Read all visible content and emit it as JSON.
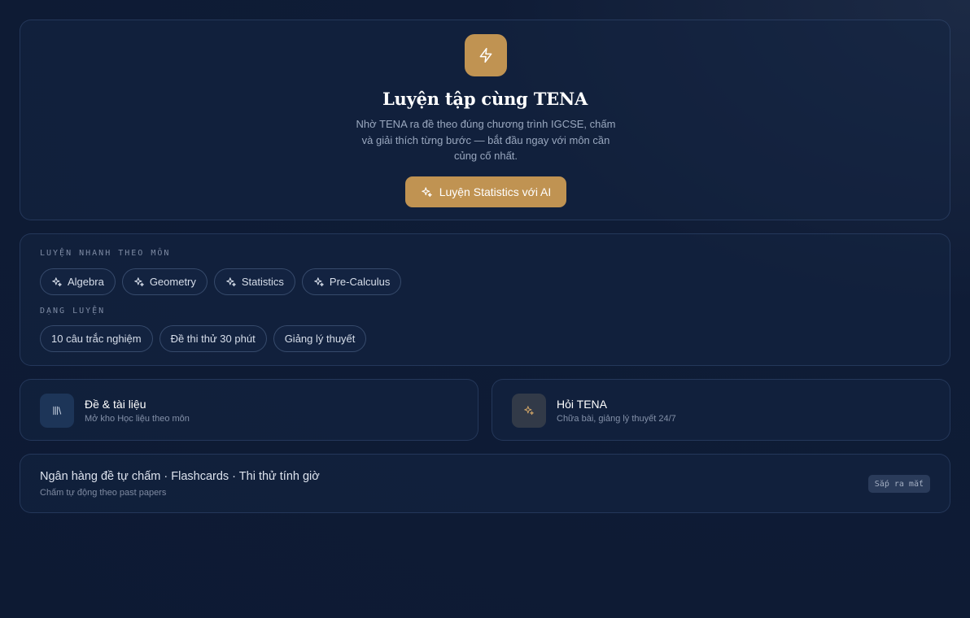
{
  "hero": {
    "icon": "lightning-icon",
    "title": "Luyện tập cùng TENA",
    "description": "Nhờ TENA ra đề theo đúng chương trình IGCSE, chấm và giải thích từng bước — bắt đầu ngay với môn cần củng cố nhất.",
    "cta_label": "Luyện Statistics với AI",
    "cta_icon": "sparkles-icon"
  },
  "quick": {
    "subjects_label": "LUYỆN NHANH THEO MÔN",
    "subjects": [
      {
        "label": "Algebra",
        "icon": "sparkles-icon"
      },
      {
        "label": "Geometry",
        "icon": "sparkles-icon"
      },
      {
        "label": "Statistics",
        "icon": "sparkles-icon"
      },
      {
        "label": "Pre-Calculus",
        "icon": "sparkles-icon"
      }
    ],
    "modes_label": "DẠNG LUYỆN",
    "modes": [
      {
        "label": "10 câu trắc nghiệm"
      },
      {
        "label": "Đề thi thử 30 phút"
      },
      {
        "label": "Giảng lý thuyết"
      }
    ]
  },
  "features": [
    {
      "title": "Đề & tài liệu",
      "subtitle": "Mở kho Học liệu theo môn",
      "icon": "library-icon"
    },
    {
      "title": "Hỏi TENA",
      "subtitle": "Chữa bài, giảng lý thuyết 24/7",
      "icon": "sparkles-icon"
    }
  ],
  "coming_soon": {
    "title": "Ngân hàng đề tự chấm · Flashcards · Thi thử tính giờ",
    "subtitle": "Chấm tự động theo past papers",
    "badge": "Sắp ra mắt"
  },
  "colors": {
    "accent": "#c09352",
    "background": "#0f1c36",
    "card": "#142442"
  }
}
